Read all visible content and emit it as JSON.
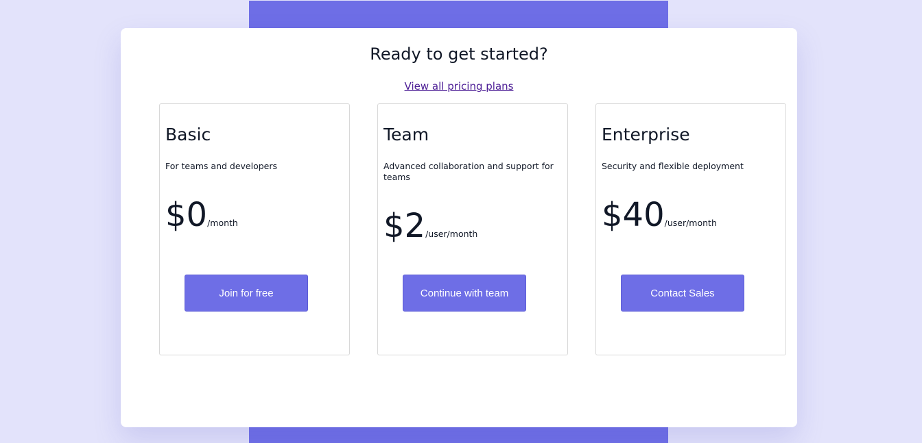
{
  "header": {
    "title": "Ready to get started?",
    "plans_link": "View all pricing plans"
  },
  "plans": [
    {
      "name": "Basic",
      "description": "For teams and developers",
      "price": "$0",
      "period": "/month",
      "button": "Join for free"
    },
    {
      "name": "Team",
      "description": "Advanced collaboration and support for teams",
      "price": "$2",
      "period": "/user/month",
      "button": "Continue with team"
    },
    {
      "name": "Enterprise",
      "description": "Security and flexible deployment",
      "price": "$40",
      "period": "/user/month",
      "button": "Contact Sales"
    }
  ],
  "colors": {
    "accent": "#6e6ee6",
    "background": "#e3e3fb",
    "link": "#4c1d95"
  }
}
